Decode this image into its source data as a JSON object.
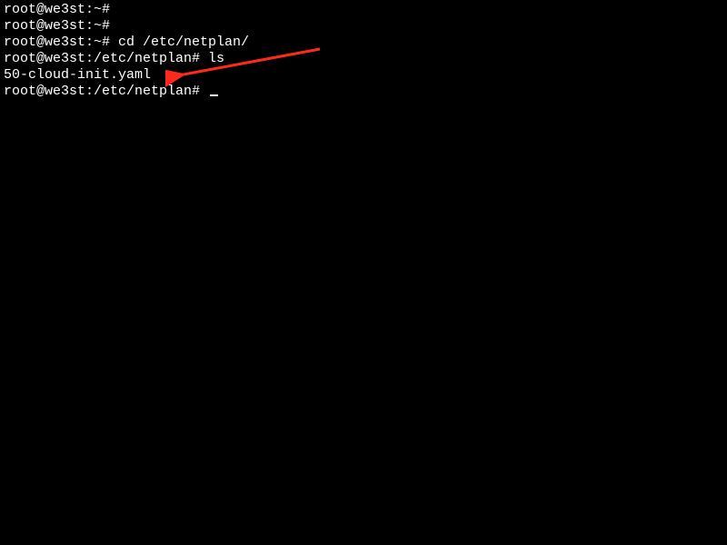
{
  "lines": {
    "l0": "root@we3st:~#",
    "l1": "root@we3st:~#",
    "l2_prompt": "root@we3st:~# ",
    "l2_cmd": "cd /etc/netplan/",
    "l3_prompt": "root@we3st:/etc/netplan# ",
    "l3_cmd": "ls",
    "l4": "50-cloud-init.yaml",
    "l5_prompt": "root@we3st:/etc/netplan# "
  },
  "annotation": {
    "color": "#ff2a1a"
  }
}
